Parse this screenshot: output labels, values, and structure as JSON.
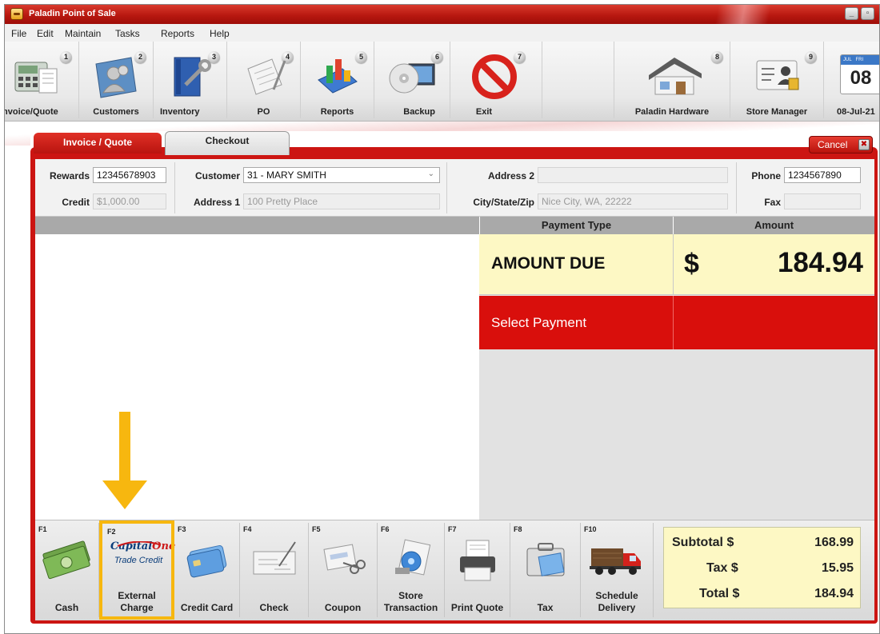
{
  "window": {
    "title": "Paladin Point of Sale",
    "minimize": "_",
    "restore": "▫"
  },
  "menu": [
    "File",
    "Edit",
    "Maintain",
    "Tasks",
    "Reports",
    "Help"
  ],
  "toolbar": {
    "items": [
      {
        "label": "Invoice/Quote",
        "number": "1",
        "icon": "cash-register-icon"
      },
      {
        "label": "Customers",
        "number": "2",
        "icon": "customers-icon"
      },
      {
        "label": "Inventory",
        "number": "3",
        "icon": "inventory-icon"
      },
      {
        "label": "PO",
        "number": "4",
        "icon": "purchase-order-icon"
      },
      {
        "label": "Reports",
        "number": "5",
        "icon": "reports-icon"
      },
      {
        "label": "Backup",
        "number": "6",
        "icon": "backup-icon"
      },
      {
        "label": "Exit",
        "number": "7",
        "icon": "exit-icon"
      },
      {
        "label": "Paladin Hardware",
        "number": "8",
        "icon": "store-icon"
      },
      {
        "label": "Store Manager",
        "number": "9",
        "icon": "store-manager-icon"
      }
    ],
    "calendar": {
      "day": "08",
      "date": "08-Jul-21",
      "strip": "JUL   FRI"
    }
  },
  "tabs": {
    "invoice": "Invoice / Quote",
    "checkout": "Checkout",
    "cancel": "Cancel",
    "cancel_x": "✖"
  },
  "customer": {
    "rewards_label": "Rewards",
    "rewards": "12345678903",
    "credit_label": "Credit",
    "credit": "$1,000.00",
    "customer_label": "Customer",
    "customer": "31 - MARY SMITH",
    "address1_label": "Address 1",
    "address1": "100 Pretty Place",
    "address2_label": "Address 2",
    "address2": "",
    "city_label": "City/State/Zip",
    "city": "Nice City, WA, 22222",
    "phone_label": "Phone",
    "phone": "1234567890",
    "fax_label": "Fax",
    "fax": ""
  },
  "payment_grid": {
    "col_type": "Payment Type",
    "col_amount": "Amount",
    "amount_due_label": "AMOUNT DUE",
    "currency": "$",
    "amount_due": "184.94",
    "select_payment": "Select Payment"
  },
  "payment_buttons": [
    {
      "fkey": "F1",
      "label": "Cash",
      "icon": "cash-icon"
    },
    {
      "fkey": "F2",
      "label": "External Charge",
      "icon": "capital-one-trade-credit-icon",
      "brand": "Capital",
      "brand2": "One",
      "brand_sub": "Trade Credit"
    },
    {
      "fkey": "F3",
      "label": "Credit Card",
      "icon": "credit-card-icon"
    },
    {
      "fkey": "F4",
      "label": "Check",
      "icon": "check-icon"
    },
    {
      "fkey": "F5",
      "label": "Coupon",
      "icon": "coupon-icon"
    },
    {
      "fkey": "F6",
      "label": "Store Transaction",
      "icon": "store-transaction-icon"
    },
    {
      "fkey": "F7",
      "label": "Print Quote",
      "icon": "printer-icon"
    },
    {
      "fkey": "F8",
      "label": "Tax",
      "icon": "tax-icon"
    },
    {
      "fkey": "F10",
      "label": "Schedule Delivery",
      "icon": "delivery-truck-icon"
    }
  ],
  "totals": {
    "subtotal_label": "Subtotal $",
    "subtotal": "168.99",
    "tax_label": "Tax $",
    "tax": "15.95",
    "total_label": "Total $",
    "total": "184.94"
  },
  "colors": {
    "brand_red": "#cc1512",
    "highlight": "#f7b70f",
    "amount_bg": "#fdf8c4"
  }
}
